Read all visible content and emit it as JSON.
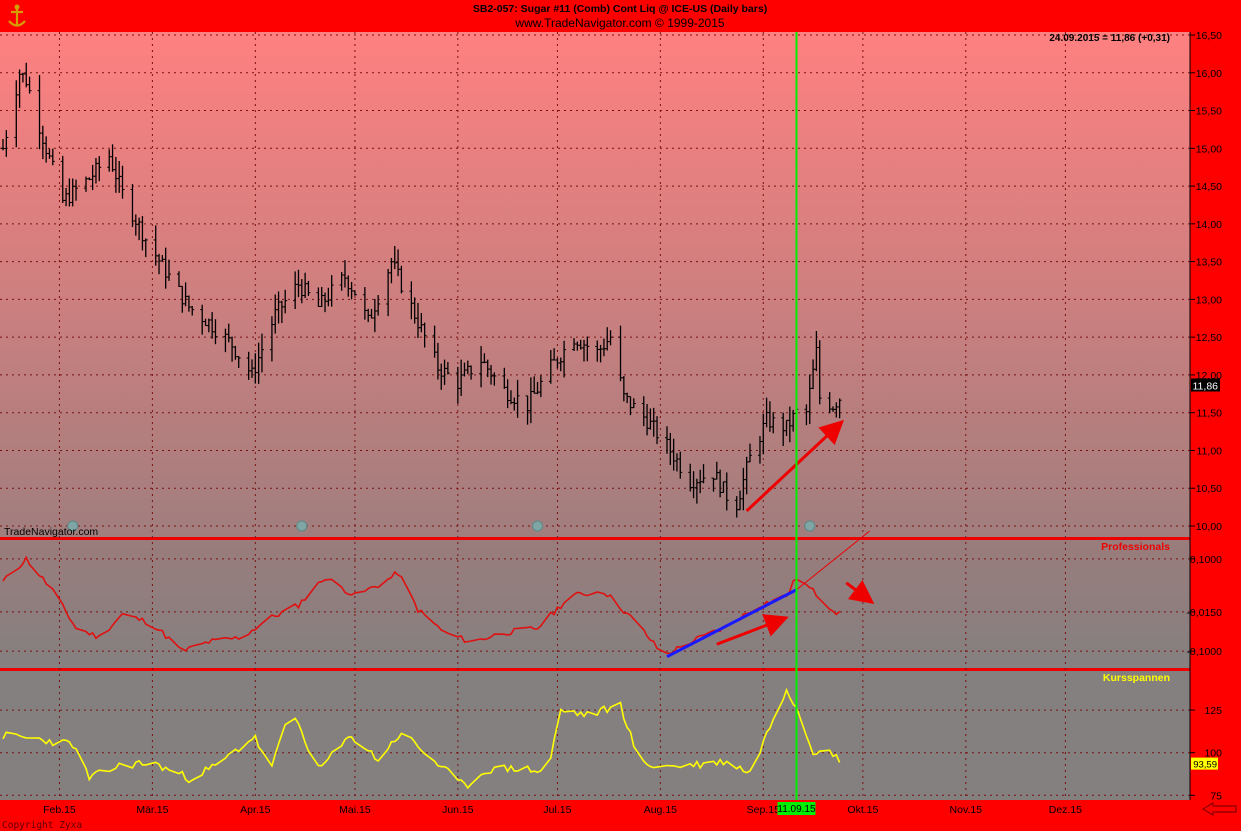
{
  "header": {
    "title": "SB2-057:  Sugar #11 (Comb) Cont Liq @ ICE-US  (Daily bars)",
    "subtitle": "www.TradeNavigator.com © 1999-2015",
    "quote": "24.09.2015 = 11,86 (+0,31)",
    "watermark": "TradeNavigator.com",
    "copyright": "Copyright Zyxa",
    "date_marker": "11.09.15",
    "back_arrow_icon": "left-arrow-icon",
    "logo_icon": "anchor-logo-icon"
  },
  "colors": {
    "frame": "#ff0000",
    "price_bg_top": "#ff8080",
    "price_bg_bottom": "#8e8080",
    "lower_bg": "#808080",
    "grid": "#7a1010",
    "bars": "#000000",
    "professionals_line": "#e01010",
    "trend_line": "#1a1aff",
    "kursspannen_line": "#ffff00",
    "cursor_line": "#00ee00",
    "arrow": "#ee0000"
  },
  "chart_data": [
    {
      "type": "ohlc",
      "name": "price",
      "title": "Sugar #11 (Comb) Cont Liq @ ICE-US (Daily bars)",
      "ylim": [
        9.9,
        16.55
      ],
      "y_ticks": [
        "16,50",
        "16,00",
        "15,50",
        "15,00",
        "14,50",
        "14,00",
        "13,50",
        "13,00",
        "12,50",
        "12,00",
        "11,50",
        "11,00",
        "10,50",
        "10,00"
      ],
      "y_tick_values": [
        16.5,
        16.0,
        15.5,
        15.0,
        14.5,
        14.0,
        13.5,
        13.0,
        12.5,
        12.0,
        11.5,
        11.0,
        10.5,
        10.0
      ],
      "last_value_label": "11,86",
      "last_value": 11.86,
      "x_labels": [
        "Feb.15",
        "Mär.15",
        "Apr.15",
        "Mai.15",
        "Jun.15",
        "Jul.15",
        "Aug.15",
        "Sep.15",
        "Okt.15",
        "Nov.15",
        "Dez.15"
      ],
      "x_domain": [
        "2015-01-15",
        "2015-12-31"
      ],
      "month_starts": [
        "2015-02-01",
        "2015-03-01",
        "2015-04-01",
        "2015-05-01",
        "2015-06-01",
        "2015-07-01",
        "2015-08-01",
        "2015-09-01",
        "2015-10-01",
        "2015-11-01",
        "2015-12-01"
      ],
      "anchors": [
        [
          "2015-01-15",
          15.0
        ],
        [
          "2015-01-20",
          16.0
        ],
        [
          "2015-01-22",
          15.9
        ],
        [
          "2015-01-28",
          15.0
        ],
        [
          "2015-02-02",
          14.3
        ],
        [
          "2015-02-10",
          14.6
        ],
        [
          "2015-02-16",
          14.9
        ],
        [
          "2015-02-20",
          14.4
        ],
        [
          "2015-02-27",
          13.8
        ],
        [
          "2015-03-06",
          13.3
        ],
        [
          "2015-03-12",
          12.9
        ],
        [
          "2015-03-18",
          12.7
        ],
        [
          "2015-03-25",
          12.4
        ],
        [
          "2015-03-31",
          12.0
        ],
        [
          "2015-04-07",
          12.8
        ],
        [
          "2015-04-14",
          13.2
        ],
        [
          "2015-04-20",
          12.9
        ],
        [
          "2015-04-28",
          13.3
        ],
        [
          "2015-05-01",
          13.1
        ],
        [
          "2015-05-05",
          12.7
        ],
        [
          "2015-05-12",
          13.5
        ],
        [
          "2015-05-19",
          12.8
        ],
        [
          "2015-05-26",
          12.1
        ],
        [
          "2015-06-01",
          11.9
        ],
        [
          "2015-06-08",
          12.2
        ],
        [
          "2015-06-15",
          11.8
        ],
        [
          "2015-06-22",
          11.6
        ],
        [
          "2015-06-29",
          12.1
        ],
        [
          "2015-07-06",
          12.5
        ],
        [
          "2015-07-13",
          12.3
        ],
        [
          "2015-07-17",
          12.5
        ],
        [
          "2015-07-21",
          11.7
        ],
        [
          "2015-07-28",
          11.4
        ],
        [
          "2015-08-04",
          11.0
        ],
        [
          "2015-08-10",
          10.6
        ],
        [
          "2015-08-17",
          10.7
        ],
        [
          "2015-08-21",
          10.4
        ],
        [
          "2015-08-24",
          10.3
        ],
        [
          "2015-08-28",
          10.9
        ],
        [
          "2015-09-02",
          11.4
        ],
        [
          "2015-09-08",
          11.3
        ],
        [
          "2015-09-11",
          11.5
        ],
        [
          "2015-09-14",
          11.5
        ],
        [
          "2015-09-17",
          12.3
        ],
        [
          "2015-09-18",
          11.7
        ],
        [
          "2015-09-22",
          11.6
        ],
        [
          "2015-09-24",
          11.7
        ]
      ],
      "annotations": [
        {
          "type": "arrow",
          "direction": "up",
          "from": [
            "2015-08-27",
            10.2
          ],
          "to": [
            "2015-09-24",
            11.35
          ]
        }
      ]
    },
    {
      "type": "line",
      "name": "Professionals",
      "legend": "Professionals",
      "ylim": [
        -0.13,
        0.13
      ],
      "y_ticks": [
        "0,1000",
        "-0,0150",
        "-0,1000"
      ],
      "y_tick_values": [
        0.1,
        -0.015,
        -0.1
      ],
      "current_value_label": "-0,0150",
      "anchors": [
        [
          "2015-01-15",
          0.05
        ],
        [
          "2015-01-22",
          0.1
        ],
        [
          "2015-01-30",
          0.03
        ],
        [
          "2015-02-06",
          -0.05
        ],
        [
          "2015-02-13",
          -0.07
        ],
        [
          "2015-02-20",
          -0.02
        ],
        [
          "2015-03-01",
          -0.04
        ],
        [
          "2015-03-10",
          -0.1
        ],
        [
          "2015-03-18",
          -0.08
        ],
        [
          "2015-03-28",
          -0.07
        ],
        [
          "2015-04-05",
          -0.03
        ],
        [
          "2015-04-14",
          0.0
        ],
        [
          "2015-04-22",
          0.06
        ],
        [
          "2015-05-01",
          0.02
        ],
        [
          "2015-05-10",
          0.05
        ],
        [
          "2015-05-14",
          0.07
        ],
        [
          "2015-05-20",
          -0.01
        ],
        [
          "2015-05-28",
          -0.06
        ],
        [
          "2015-06-05",
          -0.08
        ],
        [
          "2015-06-15",
          -0.06
        ],
        [
          "2015-06-25",
          -0.05
        ],
        [
          "2015-07-05",
          0.02
        ],
        [
          "2015-07-15",
          0.03
        ],
        [
          "2015-07-25",
          -0.04
        ],
        [
          "2015-08-02",
          -0.11
        ],
        [
          "2015-08-10",
          -0.08
        ],
        [
          "2015-08-20",
          -0.05
        ],
        [
          "2015-08-31",
          0.0
        ],
        [
          "2015-09-08",
          0.02
        ],
        [
          "2015-09-11",
          0.06
        ],
        [
          "2015-09-16",
          0.03
        ],
        [
          "2015-09-22",
          -0.01
        ],
        [
          "2015-09-24",
          -0.02
        ]
      ],
      "annotations": [
        {
          "type": "line",
          "color": "blue",
          "from": [
            "2015-08-03",
            -0.112
          ],
          "to": [
            "2015-09-11",
            0.033
          ]
        },
        {
          "type": "line",
          "color": "red-thin",
          "from": [
            "2015-09-11",
            0.033
          ],
          "to": [
            "2015-10-03",
            0.16
          ]
        },
        {
          "type": "arrow",
          "direction": "up",
          "from": [
            "2015-08-18",
            -0.085
          ],
          "to": [
            "2015-09-07",
            -0.03
          ]
        },
        {
          "type": "arrow",
          "direction": "down",
          "from": [
            "2015-09-26",
            0.048
          ],
          "to": [
            "2015-10-03",
            0.01
          ]
        }
      ]
    },
    {
      "type": "line",
      "name": "Kursspannen",
      "legend": "Kursspannen",
      "ylim": [
        74,
        145
      ],
      "y_ticks": [
        "125",
        "100",
        "75"
      ],
      "y_tick_values": [
        125,
        100,
        75
      ],
      "current_value_label": "93,59",
      "current_value": 93.59,
      "anchors": [
        [
          "2015-01-15",
          110
        ],
        [
          "2015-01-25",
          108
        ],
        [
          "2015-02-05",
          105
        ],
        [
          "2015-02-10",
          85
        ],
        [
          "2015-02-20",
          93
        ],
        [
          "2015-03-01",
          94
        ],
        [
          "2015-03-12",
          85
        ],
        [
          "2015-03-20",
          92
        ],
        [
          "2015-04-01",
          110
        ],
        [
          "2015-04-05",
          88
        ],
        [
          "2015-04-12",
          125
        ],
        [
          "2015-04-20",
          90
        ],
        [
          "2015-04-30",
          110
        ],
        [
          "2015-05-08",
          96
        ],
        [
          "2015-05-15",
          112
        ],
        [
          "2015-05-25",
          95
        ],
        [
          "2015-06-03",
          80
        ],
        [
          "2015-06-10",
          90
        ],
        [
          "2015-06-20",
          91
        ],
        [
          "2015-06-28",
          88
        ],
        [
          "2015-07-02",
          125
        ],
        [
          "2015-07-10",
          122
        ],
        [
          "2015-07-20",
          128
        ],
        [
          "2015-07-26",
          93
        ],
        [
          "2015-08-04",
          92
        ],
        [
          "2015-08-12",
          93
        ],
        [
          "2015-08-21",
          95
        ],
        [
          "2015-08-28",
          88
        ],
        [
          "2015-09-04",
          120
        ],
        [
          "2015-09-08",
          138
        ],
        [
          "2015-09-12",
          123
        ],
        [
          "2015-09-16",
          100
        ],
        [
          "2015-09-20",
          106
        ],
        [
          "2015-09-24",
          94
        ]
      ]
    }
  ]
}
